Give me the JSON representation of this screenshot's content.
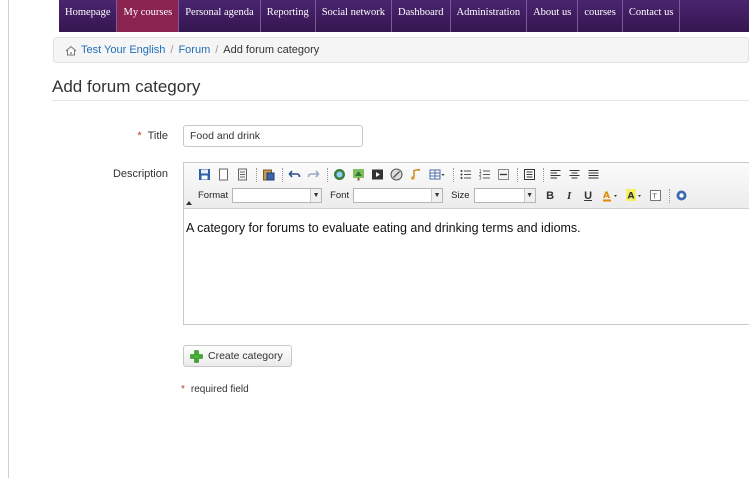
{
  "nav": {
    "items": [
      {
        "label": "Homepage",
        "active": false
      },
      {
        "label": "My courses",
        "active": true
      },
      {
        "label": "Personal agenda",
        "active": false
      },
      {
        "label": "Reporting",
        "active": false
      },
      {
        "label": "Social network",
        "active": false
      },
      {
        "label": "Dashboard",
        "active": false
      },
      {
        "label": "Administration",
        "active": false
      },
      {
        "label": "About us",
        "active": false
      },
      {
        "label": "courses",
        "active": false
      },
      {
        "label": "Contact us",
        "active": false
      }
    ]
  },
  "breadcrumb": {
    "home_icon": "home-icon",
    "course": "Test Your English",
    "section": "Forum",
    "current": "Add forum category",
    "separator": "/"
  },
  "page": {
    "title": "Add forum category"
  },
  "form": {
    "title_label": "Title",
    "required_marker": "*",
    "title_value": "Food and drink",
    "description_label": "Description",
    "toolbar": {
      "format_label": "Format",
      "font_label": "Font",
      "size_label": "Size",
      "format_value": "",
      "font_value": "",
      "size_value": ""
    },
    "description_value": "A category for forums to evaluate eating and drinking terms and idioms.",
    "submit_label": "Create category",
    "required_note": "required field"
  },
  "colors": {
    "nav_bg": "#3f1d5f",
    "nav_active": "#8a2350",
    "link": "#1f6fb7",
    "required": "#c0392b"
  }
}
